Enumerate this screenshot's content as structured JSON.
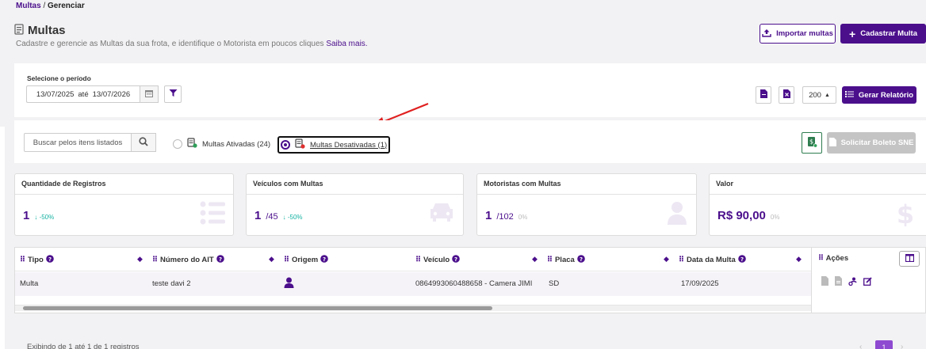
{
  "breadcrumb": {
    "parent": "Multas",
    "separator": "/",
    "current": "Gerenciar"
  },
  "header": {
    "title": "Multas",
    "subtitle": "Cadastre e gerencie as Multas da sua frota, e identifique o Motorista em poucos cliques",
    "learn_more": "Saiba mais.",
    "import_label": "Importar multas",
    "add_label": "Cadastrar Multa"
  },
  "filters": {
    "period_label": "Selecione o período",
    "date_from": "13/07/2025",
    "date_sep": "até",
    "date_to": "13/07/2026",
    "page_size": "200",
    "report_label": "Gerar Relatório"
  },
  "search": {
    "placeholder": "Buscar pelos itens listados",
    "radio_active": "Multas Ativadas (24)",
    "radio_inactive": "Multas Desativadas (1)",
    "boleto_label": "Solicitar Boleto SNE"
  },
  "cards": [
    {
      "title": "Quantidade de Registros",
      "value": "1",
      "sub": "",
      "trend": "↓ -50%",
      "trend_kind": "down",
      "icon": "list-icon"
    },
    {
      "title": "Veículos com Multas",
      "value": "1",
      "sub": "/45",
      "trend": "↓ -50%",
      "trend_kind": "down",
      "icon": "car-icon"
    },
    {
      "title": "Motoristas com Multas",
      "value": "1",
      "sub": "/102",
      "trend": "0%",
      "trend_kind": "flat",
      "icon": "user-icon"
    },
    {
      "title": "Valor",
      "value": "R$ 90,00",
      "sub": "",
      "trend": "0%",
      "trend_kind": "flat",
      "icon": "dollar-icon"
    }
  ],
  "table": {
    "columns": [
      "Tipo",
      "Número do AIT",
      "Origem",
      "Veículo",
      "Placa",
      "Data da Multa"
    ],
    "rows": [
      {
        "tipo": "Multa",
        "ait": "teste davi 2",
        "origem": "user-icon",
        "veiculo": "086499306048865​8 - Camera JIMI",
        "placa": "SD",
        "data": "17/09/2025"
      }
    ],
    "actions_header": "Ações"
  },
  "footer": {
    "info": "Exibindo de 1 até 1 de 1 registros",
    "page": "1"
  },
  "colors": {
    "brand": "#4b0f8c",
    "trend": "#17b3a3",
    "disabled": "#c4c4c4",
    "arrow": "#e02020"
  }
}
